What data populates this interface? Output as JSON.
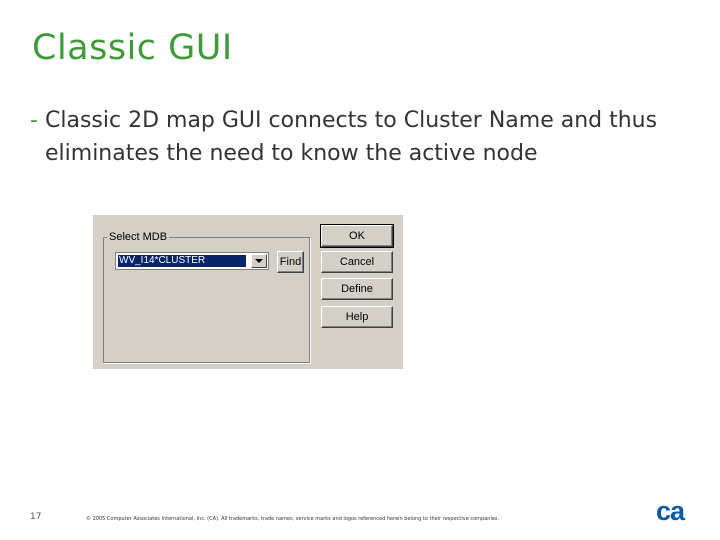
{
  "slide": {
    "title": "Classic GUI",
    "bullet": "Classic 2D map GUI connects to Cluster Name and thus eliminates the need to know the active node",
    "page_number": "17",
    "copyright": "© 2005 Computer Associates International, Inc. (CA). All trademarks, trade names, service marks and logos referenced herein belong to their respective companies.",
    "logo_text": "ca"
  },
  "dialog": {
    "group_label": "Select MDB",
    "combo_value": "WV_I14*CLUSTER",
    "find_label": "Find",
    "buttons": {
      "ok": "OK",
      "cancel": "Cancel",
      "define": "Define",
      "help": "Help"
    }
  },
  "colors": {
    "title_green": "#3f9a3a",
    "dialog_bg": "#d4d0c8",
    "selection_blue": "#0a246a",
    "logo_blue": "#0b5aa8"
  }
}
